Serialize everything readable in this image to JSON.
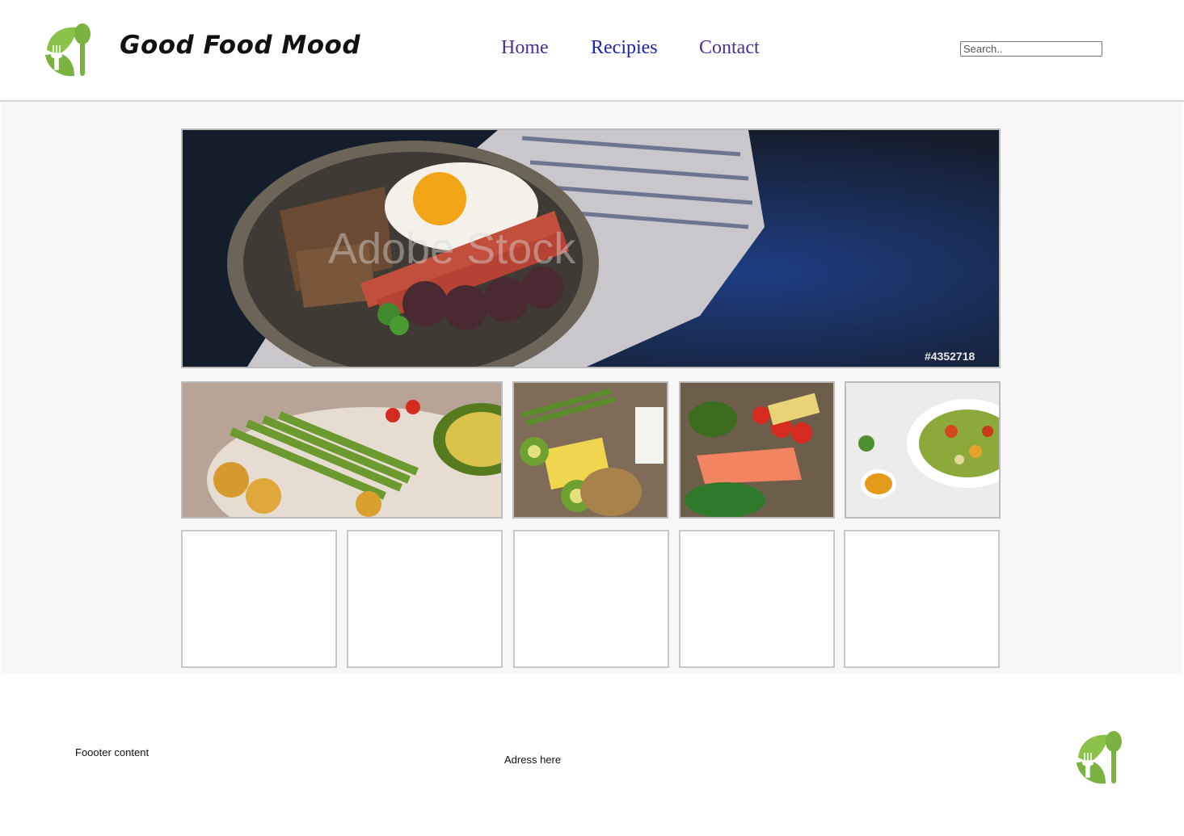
{
  "header": {
    "brand": "Good Food Mood",
    "logo_icon": "leaf-spoon-fork-icon",
    "nav": [
      {
        "label": "Home"
      },
      {
        "label": "Recipies"
      },
      {
        "label": "Contact"
      }
    ],
    "search": {
      "placeholder": "Search..",
      "value": ""
    }
  },
  "main": {
    "hero": {
      "image": "breakfast-pan-photo",
      "watermark": "Adobe Stock",
      "stock_id": "#4352718"
    },
    "thumbnails": [
      {
        "image": "vegetable-bowl-photo"
      },
      {
        "image": "healthy-ingredients-photo"
      },
      {
        "image": "salmon-vegetables-photo"
      },
      {
        "image": "salad-plate-photo"
      }
    ],
    "empty_cards": 5
  },
  "footer": {
    "content": "Foooter content",
    "address": "Adress here",
    "logo_icon": "leaf-spoon-fork-icon"
  },
  "colors": {
    "logo_green": "#7ab342",
    "nav_visited": "#4b2e96",
    "nav_link": "#1a20b8",
    "main_bg": "#f7f7f7"
  }
}
